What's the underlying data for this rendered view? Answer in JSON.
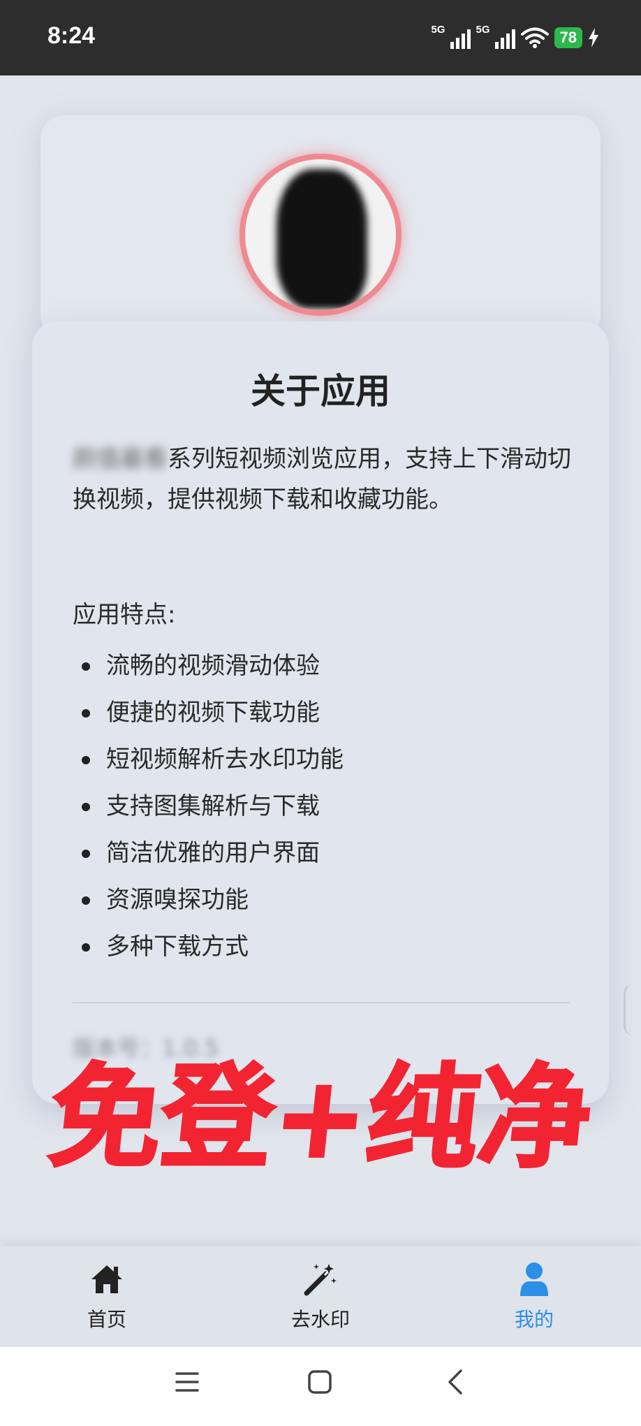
{
  "status_bar": {
    "time": "8:24",
    "network_1": "5G",
    "network_2": "5G",
    "battery": "78"
  },
  "about": {
    "title": "关于应用",
    "app_name_blurred": "颜值最看",
    "description": "系列短视频浏览应用，支持上下滑动切换视频，提供视频下载和收藏功能。",
    "features_heading": "应用特点:",
    "features": [
      "流畅的视频滑动体验",
      "便捷的视频下载功能",
      "短视频解析去水印功能",
      "支持图集解析与下载",
      "简洁优雅的用户界面",
      "资源嗅探功能",
      "多种下载方式"
    ],
    "version": "版本号：1.0.5"
  },
  "promo_text": "免登+纯净",
  "promo_color": "#f22432",
  "bottom_nav": {
    "items": [
      {
        "label": "首页",
        "icon": "home-icon"
      },
      {
        "label": "去水印",
        "icon": "magic-wand-icon"
      },
      {
        "label": "我的",
        "icon": "user-icon"
      }
    ],
    "active_index": 2,
    "active_color": "#2b8fe8"
  },
  "system_nav": {
    "icons": [
      "menu-icon",
      "home-square-icon",
      "back-icon"
    ]
  }
}
